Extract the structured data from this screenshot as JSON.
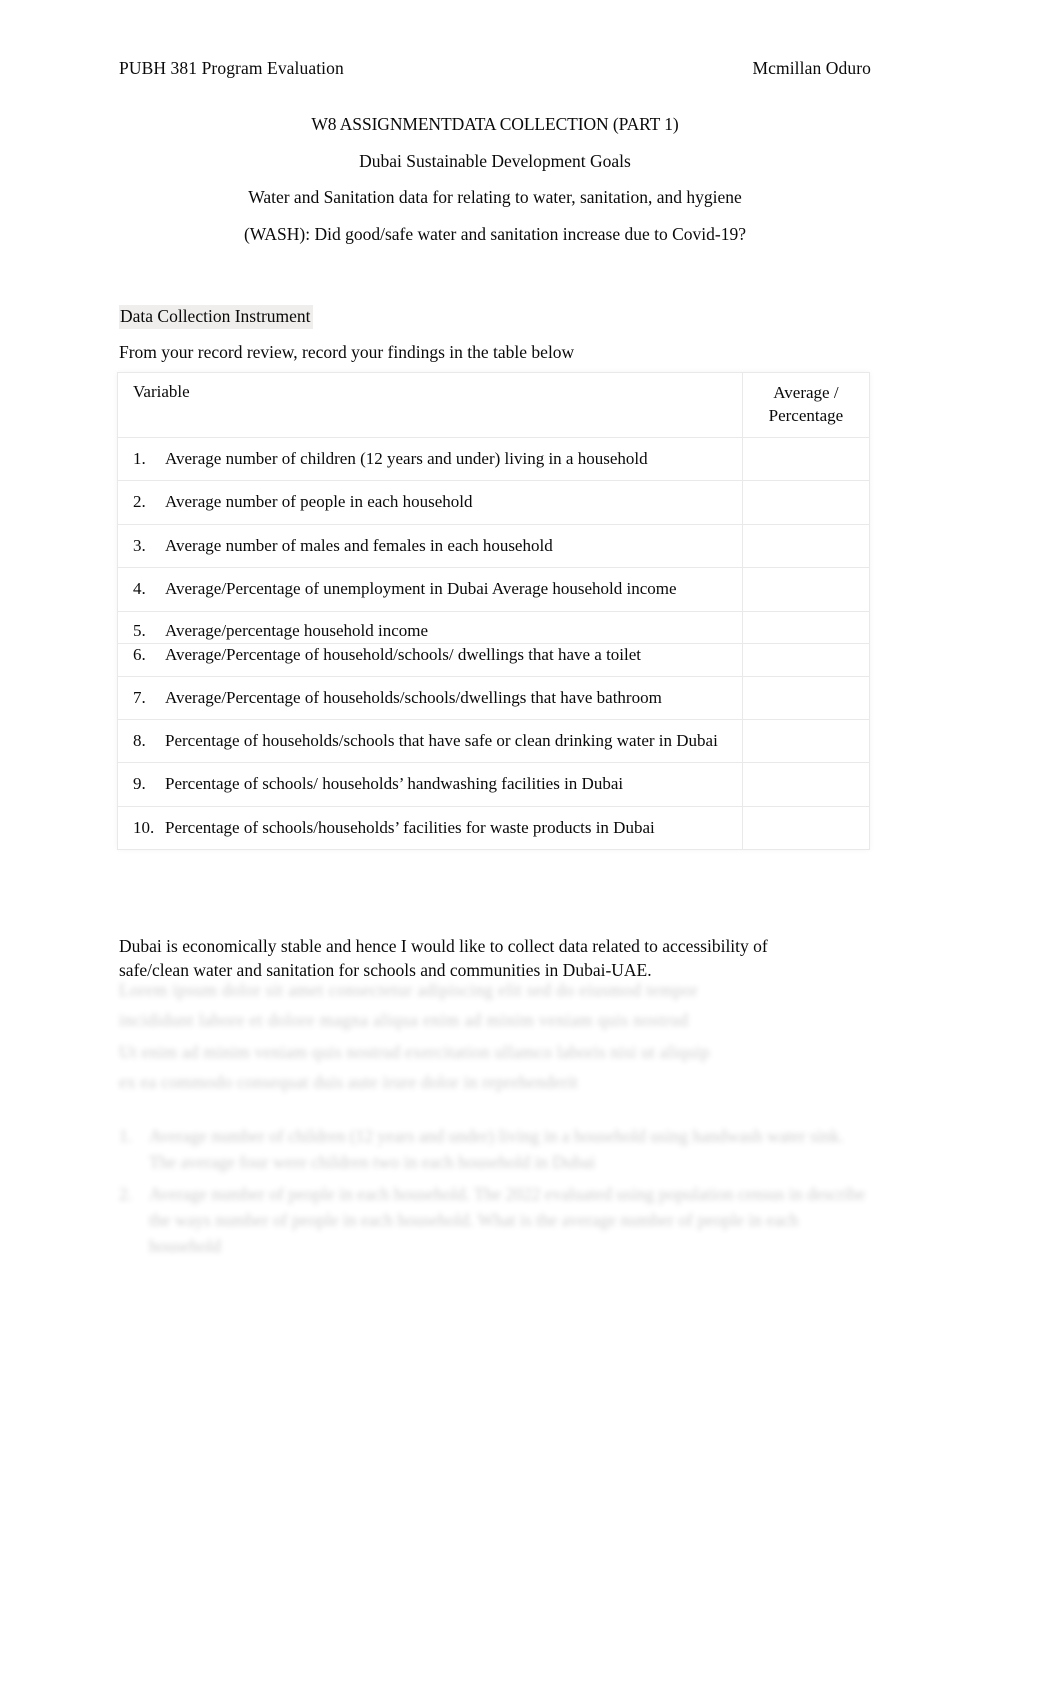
{
  "header": {
    "course": "PUBH 381 Program Evaluation",
    "author": "Mcmillan Oduro"
  },
  "title_block": {
    "line1_a": "W8 ASSIGNMENT",
    "line1_b": "DATA COLLECTION (PART 1)",
    "line2": "Dubai Sustainable Development Goals",
    "line3": "Water and Sanitation data for relating to water, sanitation, and hygiene",
    "line4": "(WASH): Did good/safe water and sanitation increase due to Covid-19?"
  },
  "section": {
    "label": "Data Collection Instrument",
    "intro": "From your record review, record your findings in the table below"
  },
  "table": {
    "headers": {
      "variable": "Variable",
      "average_line1": "Average /",
      "average_line2": "Percentage"
    },
    "rows": [
      {
        "num": "1.",
        "text": "Average number of children (12 years and under) living in a household",
        "value": ""
      },
      {
        "num": "2.",
        "text": "Average number of people in each household",
        "value": ""
      },
      {
        "num": "3.",
        "text": "Average number of males and females in each household",
        "value": ""
      },
      {
        "num": "4.",
        "text": "Average/Percentage of unemployment in Dubai Average household income",
        "value": ""
      },
      {
        "num": "5.",
        "text": "Average/percentage household income",
        "value": ""
      },
      {
        "num": "6.",
        "text": "Average/Percentage of household/schools/ dwellings that have a toilet",
        "value": ""
      },
      {
        "num": "7.",
        "text": "Average/Percentage of households/schools/dwellings that have bathroom",
        "value": ""
      },
      {
        "num": "8.",
        "text": "Percentage of households/schools that have safe or clean drinking water in Dubai",
        "value": ""
      },
      {
        "num": "9.",
        "text": "Percentage of schools/ households’ handwashing facilities in Dubai",
        "value": ""
      },
      {
        "num": "10.",
        "text": "Percentage of  schools/households’ facilities for waste products in Dubai",
        "value": ""
      }
    ]
  },
  "paragraph": {
    "text": "Dubai is economically stable and hence I would like to collect data related to accessibility of safe/clean water and sanitation for schools and communities in Dubai-UAE."
  },
  "faded_tail": {
    "note": "illegible blurred text",
    "para1_line1": "Lorem ipsum dolor sit amet consectetur adipiscing elit sed do eiusmod tempor",
    "para1_line2": "incididunt labore et dolore magna aliqua enim ad minim veniam quis nostrud",
    "para2_line1": "Ut enim ad minim veniam quis nostrud exercitation ullamco laboris nisi ut aliquip",
    "para2_line2": "ex ea commodo consequat duis aute irure dolor in reprehenderit",
    "items": [
      {
        "num": "1.",
        "line1": "Average number of children (12 years and under) living in a household",
        "line2": "using handwash water sink.  The average four were children two in each household in Dubai"
      },
      {
        "num": "2.",
        "line1": "Average number of people in each household.   The 2022 evaluated using population census in",
        "line2": "describe the ways number of people in each household. What is the average number of people",
        "line3": "in each household"
      }
    ]
  }
}
